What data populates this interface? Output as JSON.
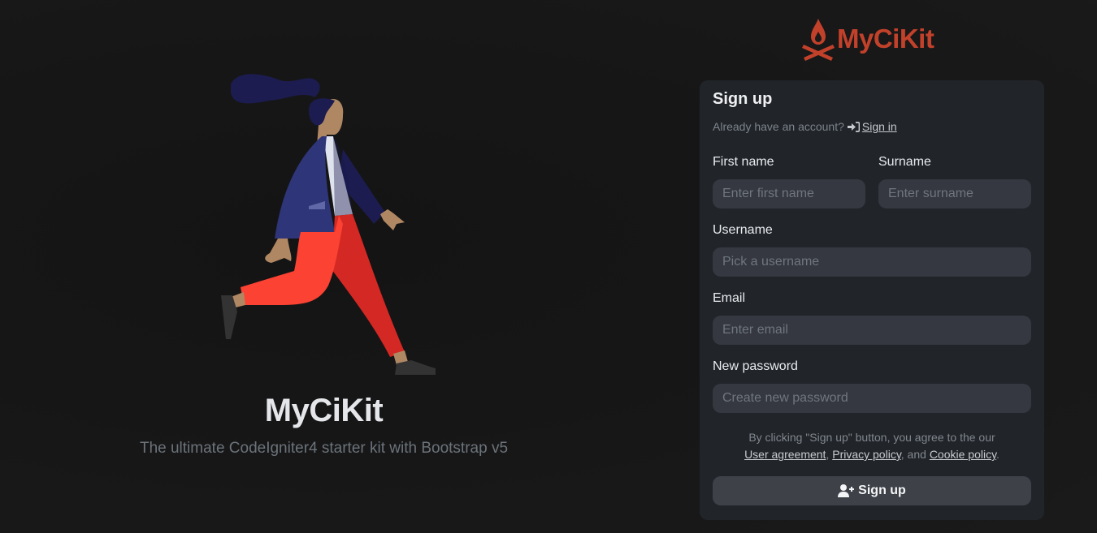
{
  "brand": {
    "name": "MyCiKit",
    "tagline": "The ultimate CodeIgniter4 starter kit with Bootstrap v5",
    "logo_text": "MyCiKit",
    "logo_icon": "campfire-icon",
    "accent_color": "#c2412a"
  },
  "illustration": {
    "name": "walking-person-illustration"
  },
  "form": {
    "title": "Sign up",
    "already_text": "Already have an account?",
    "signin_icon": "sign-in-icon",
    "signin_label": "Sign in",
    "fields": {
      "first_name": {
        "label": "First name",
        "placeholder": "Enter first name",
        "value": ""
      },
      "surname": {
        "label": "Surname",
        "placeholder": "Enter surname",
        "value": ""
      },
      "username": {
        "label": "Username",
        "placeholder": "Pick a username",
        "value": ""
      },
      "email": {
        "label": "Email",
        "placeholder": "Enter email",
        "value": ""
      },
      "password": {
        "label": "New password",
        "placeholder": "Create new password",
        "value": ""
      }
    },
    "terms": {
      "prefix": "By clicking \"Sign up\" button, you agree to the our",
      "user_agreement": "User agreement",
      "sep1": ", ",
      "privacy_policy": "Privacy policy",
      "sep2": ", and ",
      "cookie_policy": "Cookie policy",
      "suffix": "."
    },
    "submit_icon": "user-plus-icon",
    "submit_label": "Sign up"
  }
}
